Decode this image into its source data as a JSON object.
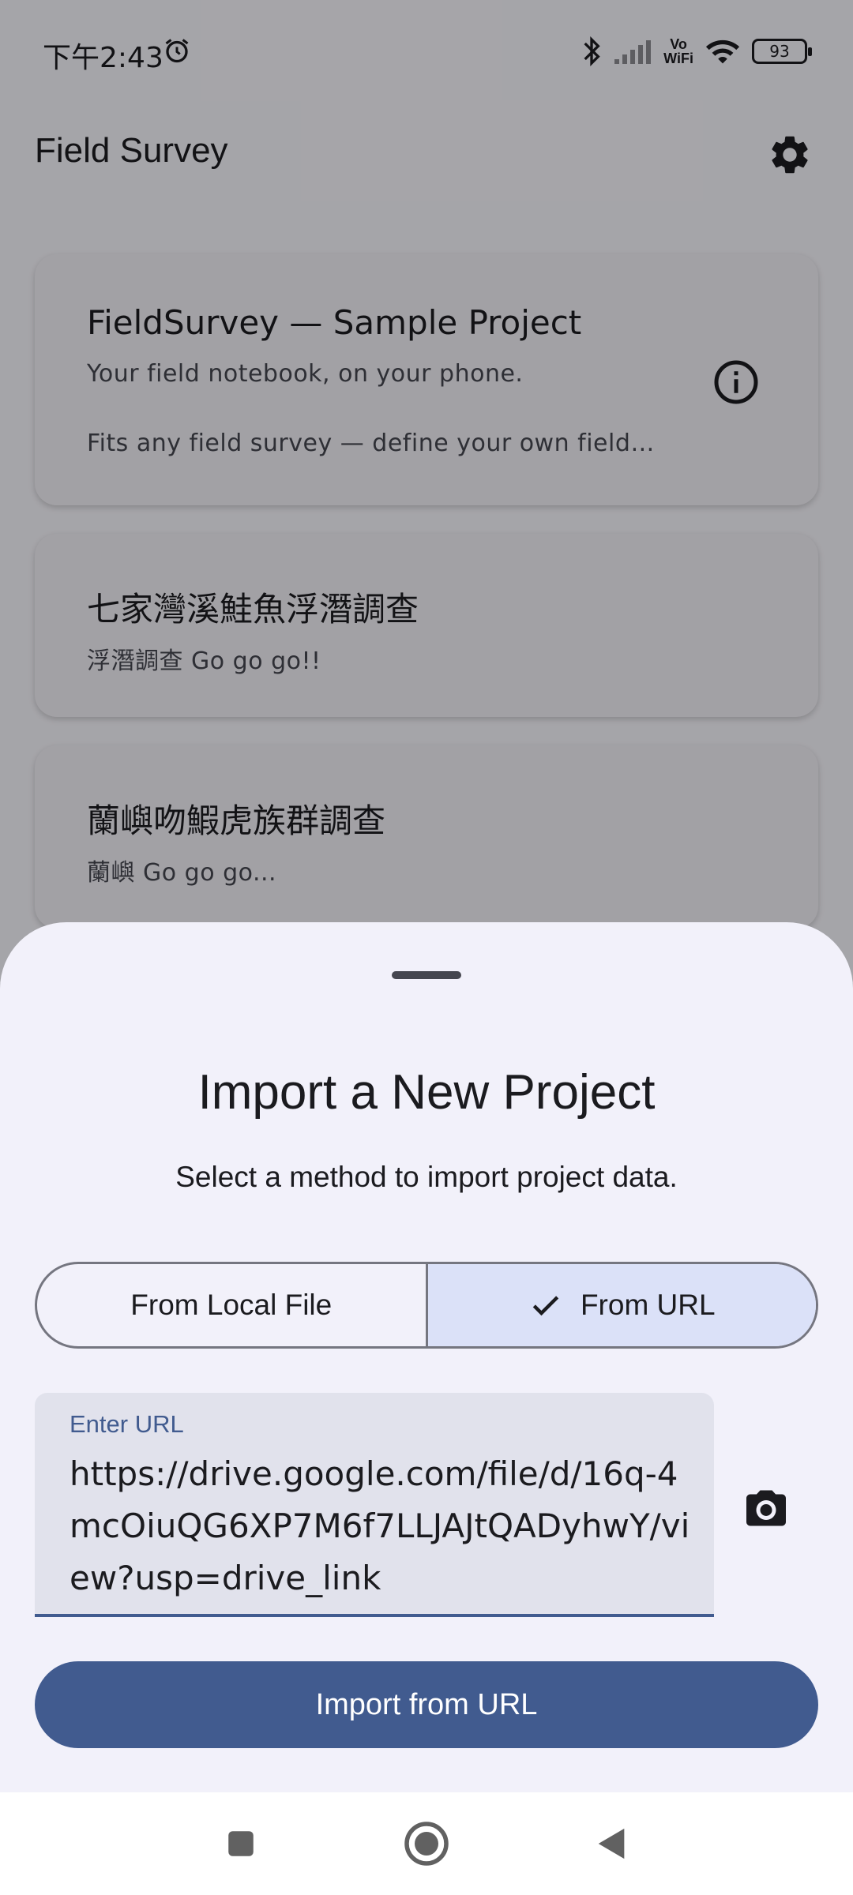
{
  "status_bar": {
    "time": "下午2:43",
    "battery": "93",
    "vowifi_line1": "Vo",
    "vowifi_line2": "WiFi"
  },
  "app_bar": {
    "title": "Field Survey",
    "settings_icon": "gear-icon"
  },
  "projects": [
    {
      "title": "FieldSurvey — Sample Project",
      "subtitle": "Your field notebook, on your phone.",
      "description": "Fits any field survey — define your own field…",
      "info_icon": "info-icon"
    },
    {
      "title": "七家灣溪鮭魚浮潛調查",
      "subtitle": "浮潛調查 Go go go!!"
    },
    {
      "title": "蘭嶼吻鰕虎族群調查",
      "subtitle": "蘭嶼 Go go go..."
    }
  ],
  "sheet": {
    "title": "Import a New Project",
    "description": "Select a method to import project data.",
    "segments": [
      {
        "label": "From Local File",
        "selected": false
      },
      {
        "label": "From URL",
        "selected": true,
        "icon": "check-icon"
      }
    ],
    "url_field": {
      "label": "Enter URL",
      "value": "https://drive.google.com/file/d/16q-4mcOiuQG6XP7M6f7LLJAJtQADyhwY/view?usp=drive_link"
    },
    "camera_icon": "camera-icon",
    "import_button": "Import from URL"
  },
  "colors": {
    "primary": "#415b8f",
    "segment_selected": "#dbe1f8",
    "sheet_background": "#f2f1fa"
  },
  "nav_bar": {
    "items": [
      "recents-icon",
      "home-icon",
      "back-icon"
    ]
  }
}
